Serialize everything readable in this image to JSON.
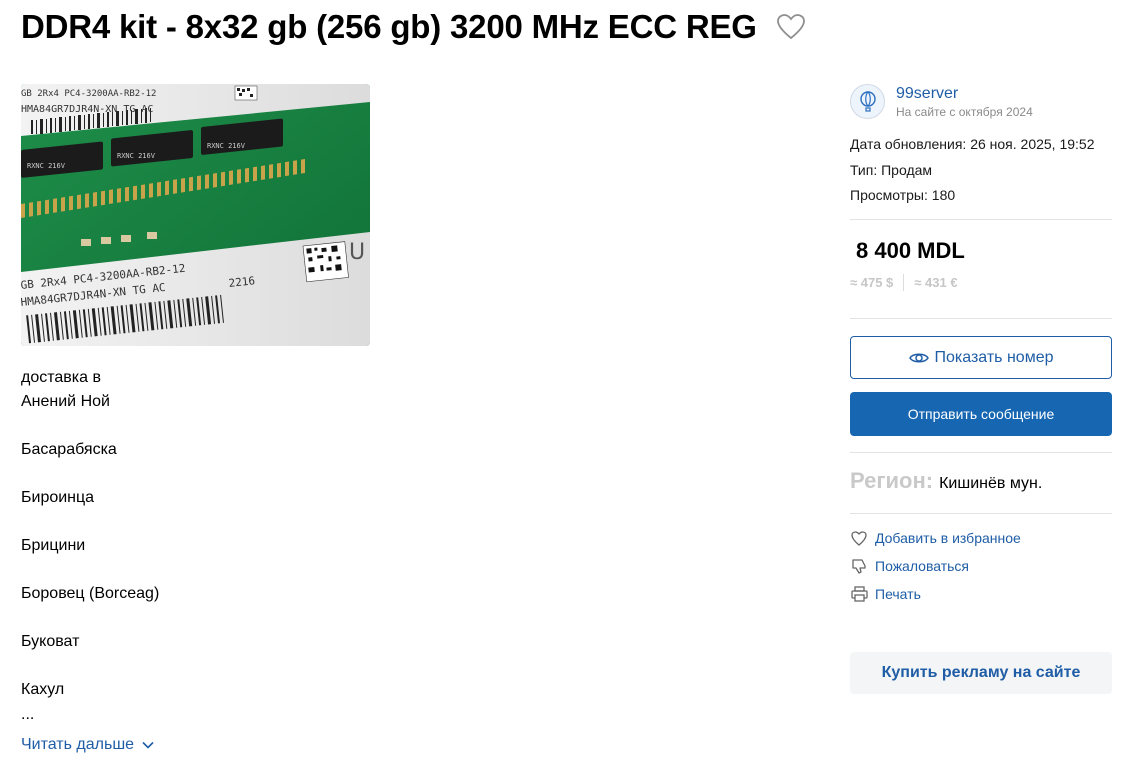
{
  "listing": {
    "title": "DDR4 kit - 8x32 gb (256 gb) 3200 MHz ECC REG",
    "photo_label_line1": "GB 2Rx4 PC4-3200AA-RB2-12",
    "photo_label_line2": "HMA84GR7DJR4N-XN TG AC",
    "photo_label_code": "2216",
    "photo_chip_text": "RXNC 216V",
    "photo_chip_text2": "• DWDRAP31XP1"
  },
  "description": {
    "lines": [
      "доставка в",
      "Анений Ной",
      "Басарабяска",
      "Бироинца",
      "Брицини",
      "Боровец (Borceag)",
      "Буковат",
      "Кахул"
    ],
    "ellipsis": "...",
    "read_more": "Читать дальше"
  },
  "seller": {
    "name": "99server",
    "since": "На сайте с октября 2024"
  },
  "meta": {
    "updated": "Дата обновления: 26 ноя. 2025, 19:52",
    "type": "Тип: Продам",
    "views": "Просмотры: 180"
  },
  "price": {
    "main": "8 400 MDL",
    "usd": "≈ 475 $",
    "eur": "≈ 431 €"
  },
  "buttons": {
    "show_phone": "Показать номер",
    "send_message": "Отправить сообщение",
    "buy_ad": "Купить рекламу на сайте"
  },
  "region": {
    "label": "Регион:",
    "value": "Кишинёв мун."
  },
  "actions": {
    "favorite": "Добавить в избранное",
    "report": "Пожаловаться",
    "print": "Печать"
  },
  "colors": {
    "link": "#1f5da6",
    "primary_button": "#1666b2",
    "muted": "#c9c9c9"
  }
}
